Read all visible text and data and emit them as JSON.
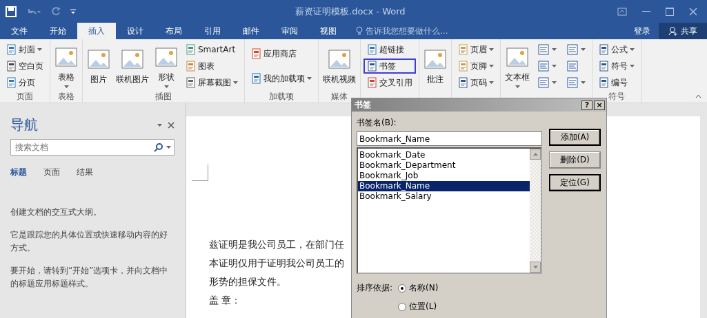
{
  "title_bar": {
    "title": "薪资证明模板.docx - Word"
  },
  "tabs": [
    {
      "label": "文件",
      "selected": false
    },
    {
      "label": "开始",
      "selected": false
    },
    {
      "label": "插入",
      "selected": true
    },
    {
      "label": "设计",
      "selected": false
    },
    {
      "label": "布局",
      "selected": false
    },
    {
      "label": "引用",
      "selected": false
    },
    {
      "label": "邮件",
      "selected": false
    },
    {
      "label": "审阅",
      "selected": false
    },
    {
      "label": "视图",
      "selected": false
    }
  ],
  "tell_me": {
    "placeholder": "告诉我您想要做什么..."
  },
  "account": {
    "sign_in": "登录",
    "share": "共享"
  },
  "ribbon_groups": [
    {
      "label": "页面",
      "columns": [
        [
          {
            "kind": "small",
            "label": "封面",
            "dropdown": true
          },
          {
            "kind": "small",
            "label": "空白页",
            "dropdown": false
          },
          {
            "kind": "small",
            "label": "分页",
            "dropdown": false
          }
        ]
      ]
    },
    {
      "label": "表格",
      "columns": [
        [
          {
            "kind": "large",
            "label": "表格",
            "dropdown": true
          }
        ]
      ]
    },
    {
      "label": "插图",
      "columns": [
        [
          {
            "kind": "large",
            "label": "图片",
            "dropdown": false
          }
        ],
        [
          {
            "kind": "large",
            "label": "联机图片",
            "dropdown": false
          }
        ],
        [
          {
            "kind": "large",
            "label": "形状",
            "dropdown": true
          }
        ],
        [
          {
            "kind": "small",
            "label": "SmartArt",
            "dropdown": false
          },
          {
            "kind": "small",
            "label": "图表",
            "dropdown": false
          },
          {
            "kind": "small",
            "label": "屏幕截图",
            "dropdown": true
          }
        ]
      ]
    },
    {
      "label": "加载项",
      "columns": [
        [
          {
            "kind": "small",
            "label": "应用商店",
            "dropdown": false
          },
          {
            "kind": "small",
            "label": "我的加载项",
            "dropdown": true
          }
        ]
      ]
    },
    {
      "label": "媒体",
      "columns": [
        [
          {
            "kind": "large",
            "label": "联机视频",
            "dropdown": false
          }
        ]
      ]
    },
    {
      "columns": [
        [
          {
            "kind": "small",
            "label": "超链接",
            "dropdown": false,
            "highlighted": false
          },
          {
            "kind": "small",
            "label": "书签",
            "dropdown": false,
            "highlighted": true
          },
          {
            "kind": "small",
            "label": "交叉引用",
            "dropdown": false,
            "highlighted": false
          }
        ]
      ]
    },
    {
      "columns": [
        [
          {
            "kind": "large",
            "label": "批注",
            "dropdown": false
          }
        ]
      ]
    },
    {
      "columns": [
        [
          {
            "kind": "small",
            "label": "页眉",
            "dropdown": true
          },
          {
            "kind": "small",
            "label": "页脚",
            "dropdown": true
          },
          {
            "kind": "small",
            "label": "页码",
            "dropdown": true
          }
        ]
      ]
    },
    {
      "columns": [
        [
          {
            "kind": "large",
            "label": "文本框",
            "dropdown": true
          }
        ],
        [
          {
            "kind": "icon",
            "dropdown": true
          },
          {
            "kind": "icon",
            "dropdown": true
          },
          {
            "kind": "icon",
            "dropdown": true
          }
        ],
        [
          {
            "kind": "icon",
            "dropdown": true
          },
          {
            "kind": "icon",
            "dropdown": false
          },
          {
            "kind": "icon",
            "dropdown": true
          }
        ]
      ]
    },
    {
      "label": "符号",
      "columns": [
        [
          {
            "kind": "small",
            "label": "公式",
            "dropdown": true
          },
          {
            "kind": "small",
            "label": "符号",
            "dropdown": true
          },
          {
            "kind": "small",
            "label": "编号",
            "dropdown": false
          }
        ]
      ]
    }
  ],
  "nav_pane": {
    "title": "导航",
    "search": {
      "placeholder": "搜索文档"
    },
    "tabs": [
      {
        "label": "标题",
        "selected": true
      },
      {
        "label": "页面",
        "selected": false
      },
      {
        "label": "结果",
        "selected": false
      }
    ],
    "paragraphs": [
      "创建文档的交互式大纲。",
      "它是跟踪您的具体位置或快速移动内容的好方式。",
      "要开始，请转到“开始”选项卡，并向文档中的标题应用标题样式。"
    ]
  },
  "document": {
    "paragraphs": [
      "兹证明是我公司员工，在部门任",
      "本证明仅用于证明我公司员工的",
      "形势的担保文件。",
      "盖 章："
    ]
  },
  "dialog": {
    "title": "书签",
    "title_buttons": [
      "?",
      "×"
    ],
    "name_label": "书签名(B):",
    "name_value": "Bookmark_Name",
    "bookmarks": [
      {
        "label": "Bookmark_Date",
        "selected": false
      },
      {
        "label": "Bookmark_Department",
        "selected": false
      },
      {
        "label": "Bookmark_Job",
        "selected": false
      },
      {
        "label": "Bookmark_Name",
        "selected": true
      },
      {
        "label": "Bookmark_Salary",
        "selected": false
      }
    ],
    "buttons": [
      {
        "label": "添加(A)",
        "default": true
      },
      {
        "label": "删除(D)",
        "default": false
      },
      {
        "label": "定位(G)",
        "default": true
      }
    ],
    "sort_label": "排序依据:",
    "sort_options": [
      {
        "label": "名称(N)",
        "selected": true
      },
      {
        "label": "位置(L)",
        "selected": false
      }
    ]
  }
}
